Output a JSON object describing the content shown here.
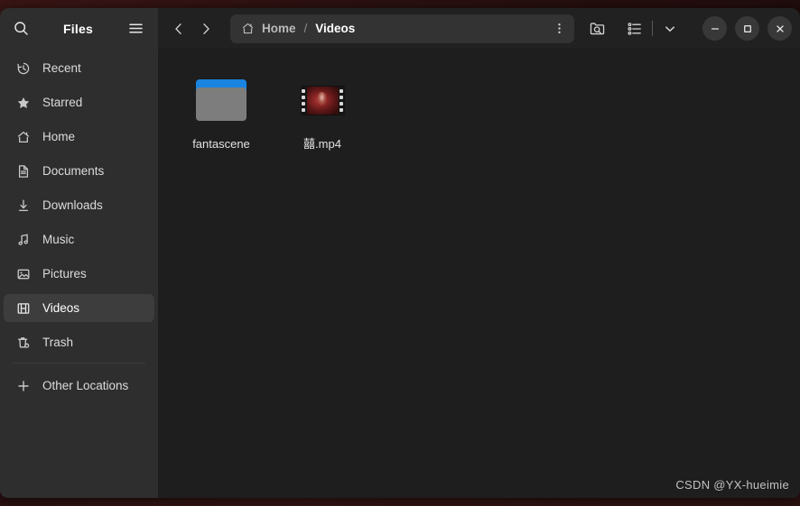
{
  "window": {
    "app_title": "Files",
    "accent_color": "#1a85e0",
    "sidebar_bg": "#2e2e2e",
    "content_bg": "#1e1e1e",
    "header_bg": "#212121"
  },
  "sidebar": {
    "title": "Files",
    "search_icon": "search-icon",
    "menu_icon": "hamburger-menu-icon",
    "items": [
      {
        "label": "Recent",
        "icon": "clock-icon",
        "selected": false
      },
      {
        "label": "Starred",
        "icon": "star-icon",
        "selected": false
      },
      {
        "label": "Home",
        "icon": "home-icon",
        "selected": false
      },
      {
        "label": "Documents",
        "icon": "document-icon",
        "selected": false
      },
      {
        "label": "Downloads",
        "icon": "download-icon",
        "selected": false
      },
      {
        "label": "Music",
        "icon": "music-note-icon",
        "selected": false
      },
      {
        "label": "Pictures",
        "icon": "image-icon",
        "selected": false
      },
      {
        "label": "Videos",
        "icon": "film-icon",
        "selected": true
      },
      {
        "label": "Trash",
        "icon": "trash-icon",
        "selected": false
      }
    ],
    "other_locations": {
      "label": "Other Locations",
      "icon": "plus-icon"
    }
  },
  "header": {
    "back_icon": "chevron-left-icon",
    "forward_icon": "chevron-right-icon",
    "breadcrumb": {
      "home_icon": "home-icon",
      "home_label": "Home",
      "separator": "/",
      "current_label": "Videos",
      "menu_icon": "vertical-dots-icon"
    },
    "search_folder_icon": "folder-search-icon",
    "view_list_icon": "list-view-icon",
    "view_dropdown_icon": "chevron-down-icon",
    "window_controls": {
      "minimize": "minimize-icon",
      "maximize": "maximize-icon",
      "close": "close-icon"
    }
  },
  "content": {
    "files": [
      {
        "name": "fantascene",
        "type": "folder"
      },
      {
        "name": "囍.mp4",
        "type": "video"
      }
    ]
  },
  "watermark": {
    "text": "CSDN @YX-hueimie"
  }
}
